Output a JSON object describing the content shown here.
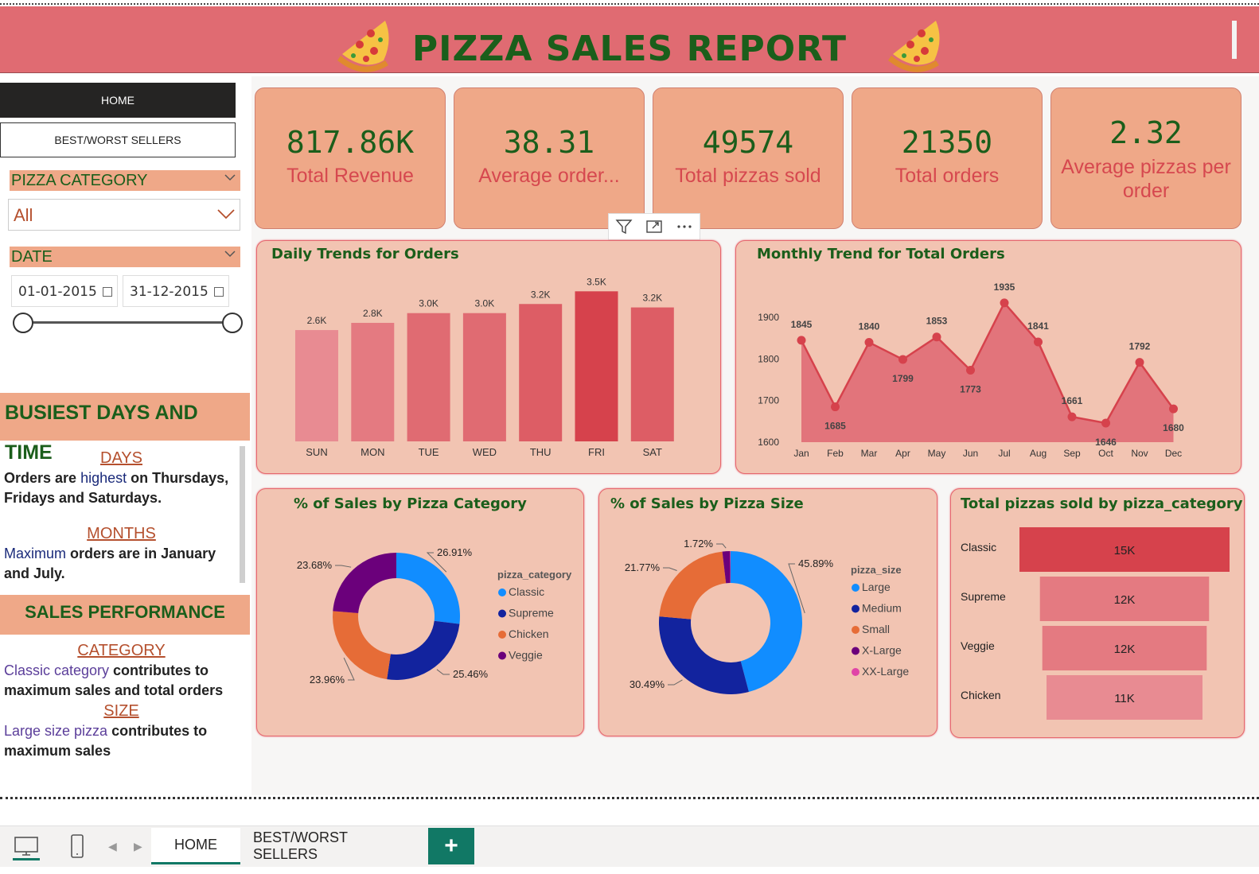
{
  "header": {
    "title": "PIZZA SALES REPORT",
    "icon": "pizza-slice-icon",
    "bg_color": "#e06b72",
    "title_color": "#1b5e1b"
  },
  "nav": {
    "home_label": "HOME",
    "best_worst_label": "BEST/WORST SELLERS"
  },
  "filters": {
    "category_header": "PIZZA CATEGORY",
    "category_value": "All",
    "date_header": "DATE",
    "date_start": "01-01-2015",
    "date_end": "31-12-2015"
  },
  "insights": {
    "busiest_header": "BUSIEST DAYS AND TIME",
    "days_title": "DAYS",
    "days_pre": "Orders are ",
    "days_highlight": "highest",
    "days_post": " on Thursdays, Fridays and Saturdays.",
    "months_title": "MONTHS",
    "months_highlight": "Maximum",
    "months_post": " orders are in  January and July.",
    "sales_header": "SALES PERFORMANCE",
    "category_title": "CATEGORY",
    "category_highlight": "Classic category",
    "category_post": " contributes to maximum sales and total orders",
    "size_title": "SIZE",
    "size_highlight": "Large size pizza",
    "size_post": " contributes to maximum sales"
  },
  "kpis": [
    {
      "value": "817.86K",
      "label": "Total Revenue"
    },
    {
      "value": "38.31",
      "label": "Average order..."
    },
    {
      "value": "49574",
      "label": "Total pizzas sold"
    },
    {
      "value": "21350",
      "label": "Total orders"
    },
    {
      "value": "2.32",
      "label": "Average pizzas per order"
    }
  ],
  "chart_data": [
    {
      "type": "bar",
      "title": "Daily Trends for Orders",
      "categories": [
        "SUN",
        "MON",
        "TUE",
        "WED",
        "THU",
        "FRI",
        "SAT"
      ],
      "values": [
        2624,
        2794,
        3024,
        3024,
        3239,
        3538,
        3158
      ],
      "data_labels": [
        "2.6K",
        "2.8K",
        "3.0K",
        "3.0K",
        "3.2K",
        "3.5K",
        "3.2K"
      ],
      "ylim": [
        0,
        3600
      ],
      "colors": [
        "#e88b92",
        "#e47a81",
        "#e06b72",
        "#e06b72",
        "#dd5d65",
        "#d6424c",
        "#dd5d65"
      ]
    },
    {
      "type": "area",
      "title": "Monthly Trend for Total Orders",
      "categories": [
        "Jan",
        "Feb",
        "Mar",
        "Apr",
        "May",
        "Jun",
        "Jul",
        "Aug",
        "Sep",
        "Oct",
        "Nov",
        "Dec"
      ],
      "values": [
        1845,
        1685,
        1840,
        1799,
        1853,
        1773,
        1935,
        1841,
        1661,
        1646,
        1792,
        1680
      ],
      "yticks": [
        1600,
        1700,
        1800,
        1900
      ],
      "ylim": [
        1600,
        1950
      ],
      "color": "#d6424c"
    },
    {
      "type": "pie",
      "title": "% of Sales by Pizza Category",
      "legend_title": "pizza_category",
      "labels": [
        "Classic",
        "Supreme",
        "Chicken",
        "Veggie"
      ],
      "values": [
        26.91,
        25.46,
        23.96,
        23.68
      ],
      "value_labels": [
        "26.91%",
        "25.46%",
        "23.96%",
        "23.68%"
      ],
      "colors": [
        "#118dff",
        "#12239e",
        "#e66c37",
        "#6b007b"
      ]
    },
    {
      "type": "pie",
      "title": "% of Sales by Pizza Size",
      "legend_title": "pizza_size",
      "labels": [
        "Large",
        "Medium",
        "Small",
        "X-Large",
        "XX-Large"
      ],
      "values": [
        45.89,
        30.49,
        21.77,
        1.72,
        0.12
      ],
      "value_labels": [
        "45.89%",
        "30.49%",
        "21.77%",
        "1.72%",
        ""
      ],
      "colors": [
        "#118dff",
        "#12239e",
        "#e66c37",
        "#6b007b",
        "#e044a7"
      ]
    },
    {
      "type": "bar",
      "title": "Total pizzas sold by pizza_category",
      "categories": [
        "Classic",
        "Supreme",
        "Veggie",
        "Chicken"
      ],
      "values": [
        14888,
        11987,
        11649,
        11050
      ],
      "data_labels": [
        "15K",
        "12K",
        "12K",
        "11K"
      ],
      "colors": [
        "#d6424c",
        "#e47a81",
        "#e47a81",
        "#e88b92"
      ]
    }
  ],
  "toolbar": {
    "filter_icon": "filter-icon",
    "focus_icon": "focus-mode-icon",
    "more_icon": "more-options-icon"
  },
  "tabs": {
    "home": "HOME",
    "best_worst": "BEST/WORST SELLERS",
    "add": "+"
  }
}
